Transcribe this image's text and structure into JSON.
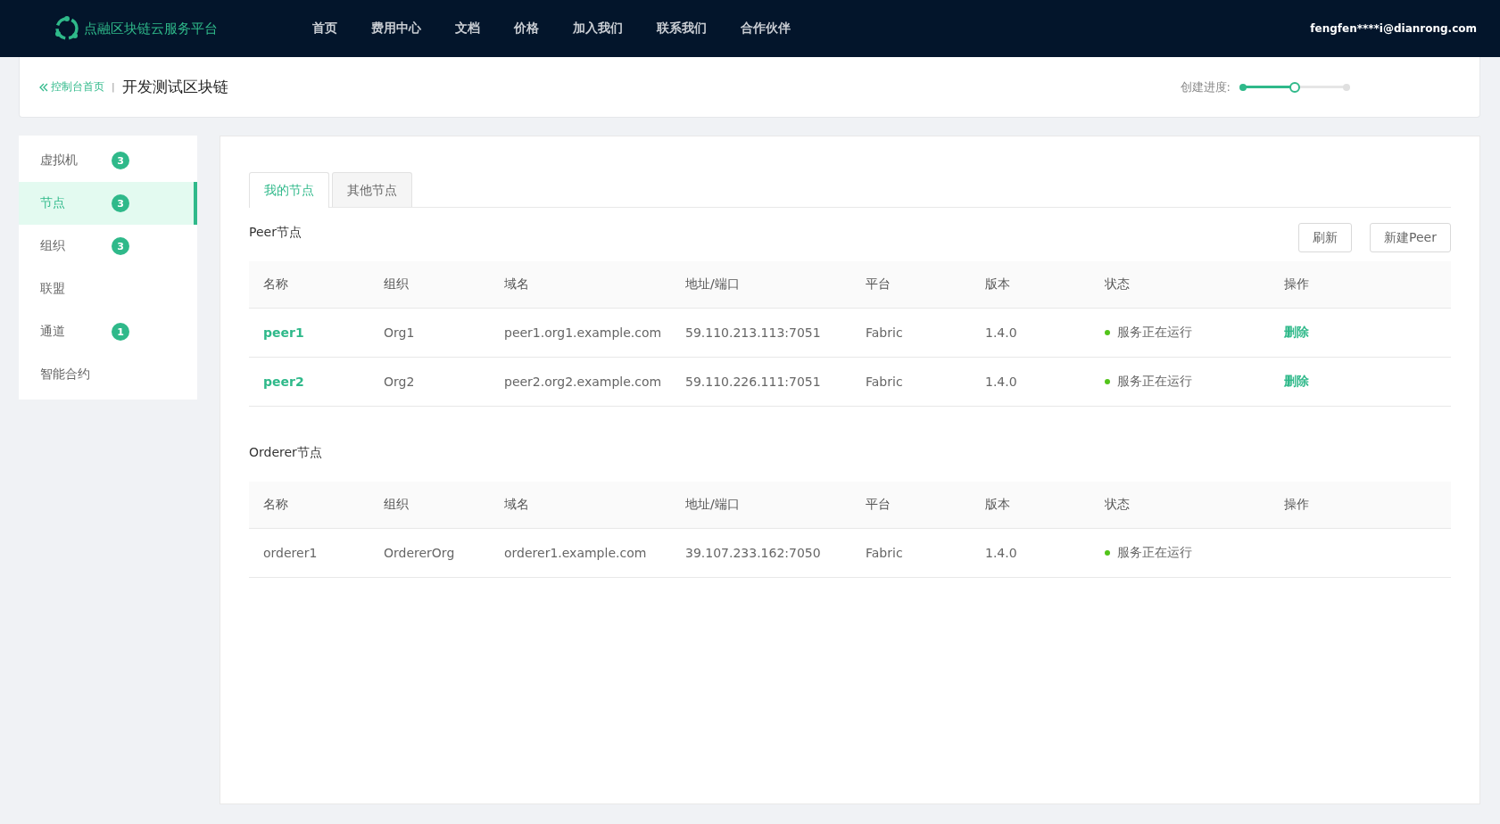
{
  "header": {
    "logo_text": "点融区块链云服务平台",
    "nav": [
      "首页",
      "费用中心",
      "文档",
      "价格",
      "加入我们",
      "联系我们",
      "合作伙伴"
    ],
    "user": "fengfen****i@dianrong.com"
  },
  "breadcrumb": {
    "back": "控制台首页",
    "separator": "|",
    "title": "开发测试区块链"
  },
  "progress": {
    "label": "创建进度:",
    "level": 0.5
  },
  "sidebar": {
    "items": [
      {
        "label": "虚拟机",
        "count": "3",
        "selected": false
      },
      {
        "label": "节点",
        "count": "3",
        "selected": true
      },
      {
        "label": "组织",
        "count": "3",
        "selected": false
      },
      {
        "label": "联盟",
        "selected": false
      },
      {
        "label": "通道",
        "count": "1",
        "selected": false
      },
      {
        "label": "智能合约",
        "selected": false
      }
    ]
  },
  "tabs": [
    {
      "label": "我的节点",
      "selected": true
    },
    {
      "label": "其他节点",
      "selected": false
    }
  ],
  "sections": [
    {
      "title": "Peer节点",
      "buttons": [
        "刷新",
        "新建Peer"
      ],
      "columns": [
        "名称",
        "组织",
        "域名",
        "地址/端口",
        "平台",
        "版本",
        "状态",
        "操作"
      ],
      "rows": [
        {
          "name": "peer1",
          "name_is_link": true,
          "org": "Org1",
          "domain": "peer1.org1.example.com",
          "address": "59.110.213.113:7051",
          "platform": "Fabric",
          "version": "1.4.0",
          "status": "服务正在运行",
          "action": "删除"
        },
        {
          "name": "peer2",
          "name_is_link": true,
          "org": "Org2",
          "domain": "peer2.org2.example.com",
          "address": "59.110.226.111:7051",
          "platform": "Fabric",
          "version": "1.4.0",
          "status": "服务正在运行",
          "action": "删除"
        }
      ]
    },
    {
      "title": "Orderer节点",
      "columns": [
        "名称",
        "组织",
        "域名",
        "地址/端口",
        "平台",
        "版本",
        "状态",
        "操作"
      ],
      "rows": [
        {
          "name": "orderer1",
          "name_is_link": false,
          "org": "OrdererOrg",
          "domain": "orderer1.example.com",
          "address": "39.107.233.162:7050",
          "platform": "Fabric",
          "version": "1.4.0",
          "status": "服务正在运行"
        }
      ]
    }
  ]
}
